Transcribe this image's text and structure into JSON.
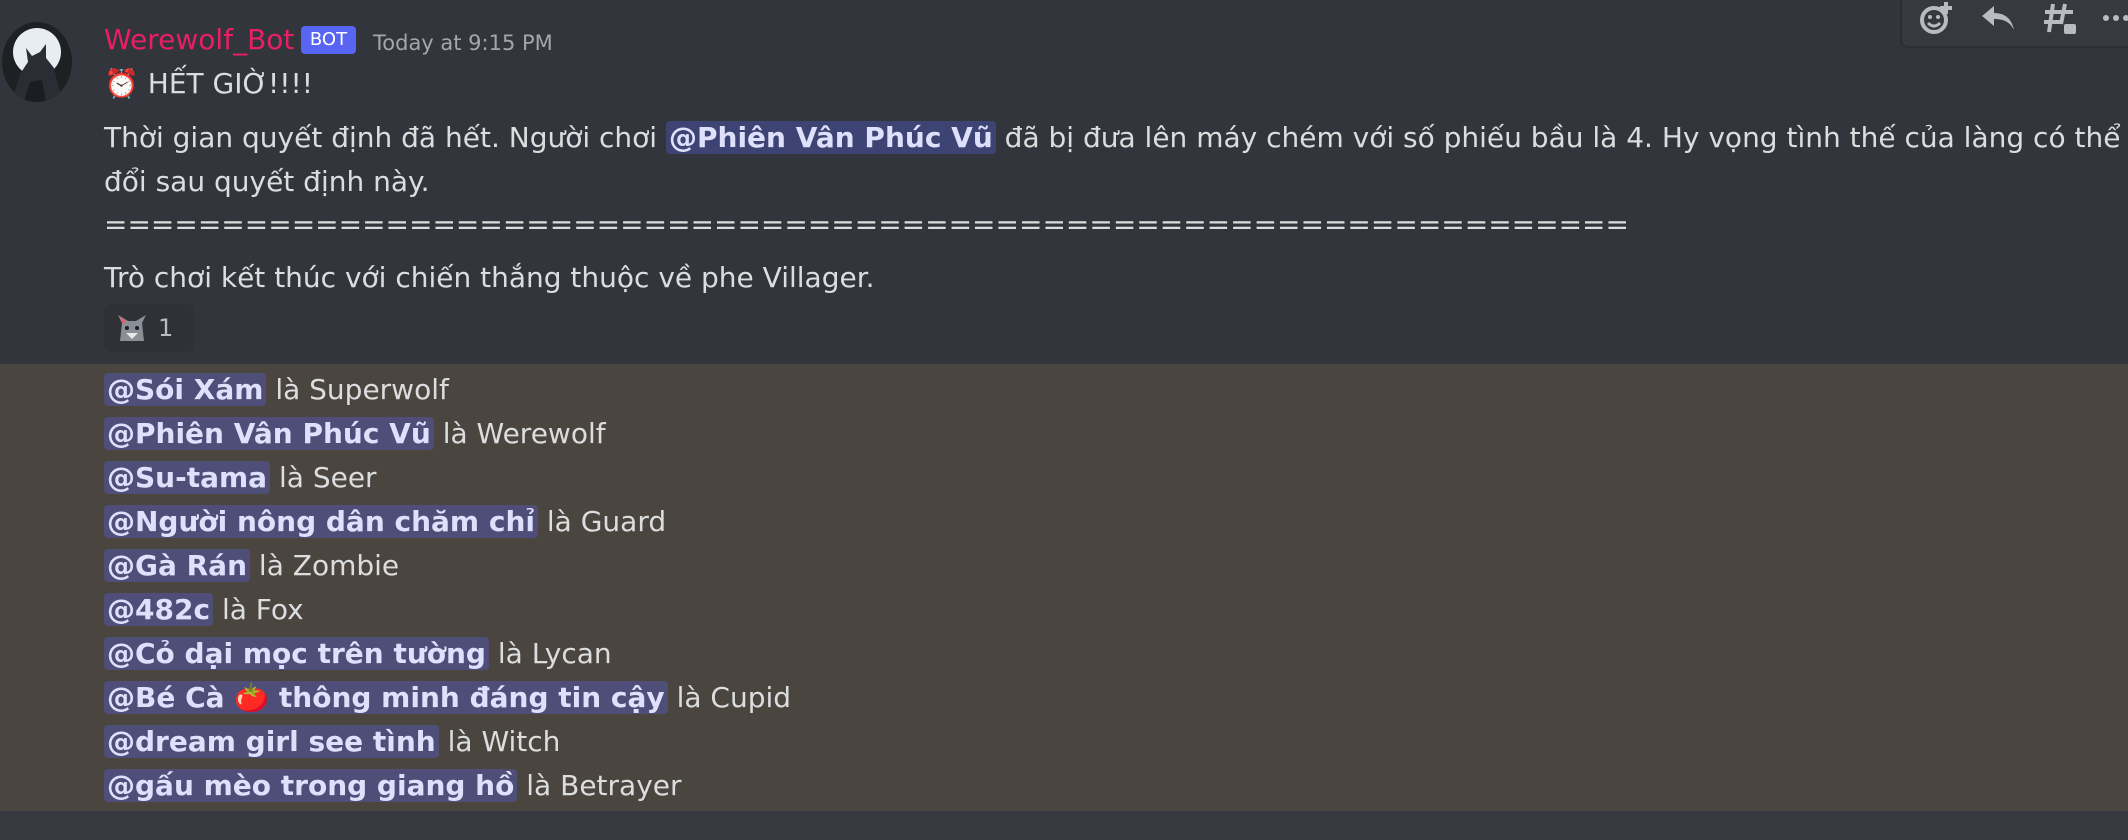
{
  "message": {
    "author": "Werewolf_Bot",
    "bot_tag": "BOT",
    "timestamp": "Today at 9:15 PM",
    "title_emoji": "⏰",
    "title": "HẾT GIỜ!!!!",
    "body_pre": "Thời gian quyết định đã hết. Người chơi",
    "body_mention": "@Phiên Vân Phúc Vũ",
    "body_post": "đã bị đưa lên máy chém với số phiếu bầu là 4. Hy vọng tình thế của làng có thể thay",
    "body_line2": "đổi sau quyết định này.",
    "separator": "=================================================================",
    "result": "Trò chơi kết thúc với chiến thắng thuộc về phe Villager."
  },
  "reaction": {
    "icon": "wolf-emoji",
    "count": "1"
  },
  "toolbar": {
    "icons": [
      "add-reaction-icon",
      "reply-icon",
      "create-thread-icon",
      "more-icon"
    ]
  },
  "roles": [
    {
      "mention": "@Sói Xám",
      "role": "là Superwolf"
    },
    {
      "mention": "@Phiên Vân Phúc Vũ",
      "role": "là Werewolf"
    },
    {
      "mention": "@Su-tama",
      "role": "là Seer"
    },
    {
      "mention": "@Người nông dân chăm chỉ",
      "role": "là Guard"
    },
    {
      "mention": "@Gà Rán",
      "role": "là Zombie"
    },
    {
      "mention": "@482c",
      "role": "là Fox"
    },
    {
      "mention": "@Cỏ dại mọc trên tường",
      "role": "là Lycan"
    },
    {
      "mention_pre": "@Bé Cà",
      "mention_emoji": "🍅",
      "mention_post": "thông minh đáng tin cậy",
      "role": "là Cupid"
    },
    {
      "mention": "@dream girl see tình",
      "role": "là Witch"
    },
    {
      "mention": "@gấu mèo trong giang hồ",
      "role": "là Betrayer"
    }
  ],
  "colors": {
    "username": "#e91e63",
    "bot_tag": "#5865f2",
    "mention_bg": "rgba(88,101,242,0.30)",
    "results_bg": "#4b4540"
  }
}
